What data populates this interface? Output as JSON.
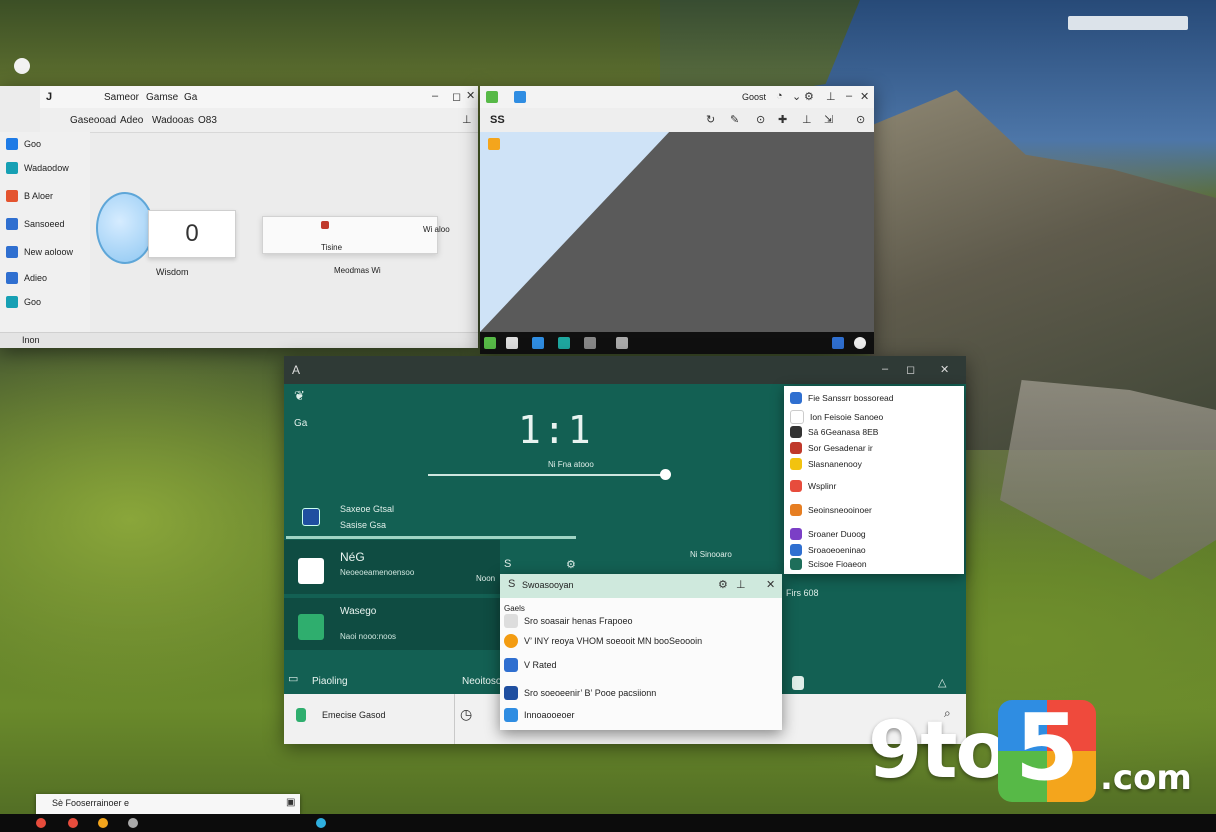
{
  "desktop": {
    "colors": {
      "accent_green": "#136053",
      "popup_header": "#cfe9dd"
    }
  },
  "window1": {
    "title_left": "J",
    "title_items": [
      "Sameor",
      "Gamse",
      "Ga"
    ],
    "menu_items": [
      "Gaseooad",
      "Adeo",
      "Wadooas",
      "O83"
    ],
    "sidebar": [
      {
        "label": "Goo",
        "icon": "blue-square-icon"
      },
      {
        "label": "Wadaodow",
        "icon": "teal-app-icon"
      },
      {
        "label": "B Aloer",
        "icon": "orange-app-icon"
      },
      {
        "label": "Sansoeed",
        "icon": "blue-app-icon"
      },
      {
        "label": "New aoloow",
        "icon": "blue-app-icon"
      },
      {
        "label": "Adieo",
        "icon": "blue-app-icon"
      },
      {
        "label": "Goo",
        "icon": "teal-app-icon"
      }
    ],
    "counter_value": "0",
    "dial_caption": "Wisdom",
    "card_title": "Tisine",
    "card_label": "Wi aloo",
    "card_caption": "Meodmas Wi",
    "status_left": "Inon"
  },
  "window2": {
    "title_right": "Goost",
    "toolbar_left": "SS"
  },
  "window3": {
    "title_icon": "A",
    "left_labels": [
      "Ga"
    ],
    "clock": "1:1",
    "clock_caption": "Ni Fna atooo",
    "item1": {
      "title": "Saxeoe Gtsal",
      "subtitle": "Sasise Gsa"
    },
    "item2": {
      "title": "NéG",
      "subtitle": "Neoeoeamenoensoo"
    },
    "item3": {
      "title": "Wasego",
      "subtitle": "Naoi nooo:noos"
    },
    "mid_label": "Noon",
    "right_label": "Ni Sinooaro",
    "right_label2": "Firs 608",
    "section_label": "Piaoling",
    "section_label2": "Neoitoso",
    "bottom_text": "Emecise Gasod"
  },
  "popup": {
    "items": [
      {
        "label": "Fie Sanssrr bossoread",
        "color": "#2f6fd0"
      },
      {
        "label": "Ion Feisoie Sanoeo",
        "color": "#ffffff"
      },
      {
        "label": "Sā 6Geanasa 8EB",
        "color": "#333333"
      },
      {
        "label": "Sor Gesadenar ir",
        "color": "#c0392b"
      },
      {
        "label": "Slasnanenooy",
        "color": "#f2c30f"
      },
      {
        "label": "Wsplinr",
        "color": "#e74c3c"
      },
      {
        "label": "Seoinsneooinoer",
        "color": "#e67e22"
      },
      {
        "label": "Sroaner Duoog",
        "color": "#7b3fc6"
      },
      {
        "label": "Sroaoeoeninao",
        "color": "#2f6fd0"
      },
      {
        "label": "Scisoe Fioaeon",
        "color": "#1e6e5a"
      }
    ]
  },
  "dialog": {
    "title": "Swoasooyan",
    "section": "Gaels",
    "items": [
      {
        "label": "Sro soasair henas Frapoeo",
        "color": "#dddddd"
      },
      {
        "label": "V’ INY reoya VHOM soeooit MN booSeoooin",
        "color": "#f39c12"
      },
      {
        "label": "V Rated",
        "color": "#2f6fd0"
      },
      {
        "label": "Sro soeoeenir’ B’ Pooe pacsiionn",
        "color": "#1f4fa0"
      },
      {
        "label": "Innoaooeoer",
        "color": "#2f8de2"
      }
    ]
  },
  "notification": {
    "text": "Sè Fooserrainoer e"
  },
  "watermark": {
    "part1": "9to",
    "part2": "5",
    "part3": ".com"
  }
}
